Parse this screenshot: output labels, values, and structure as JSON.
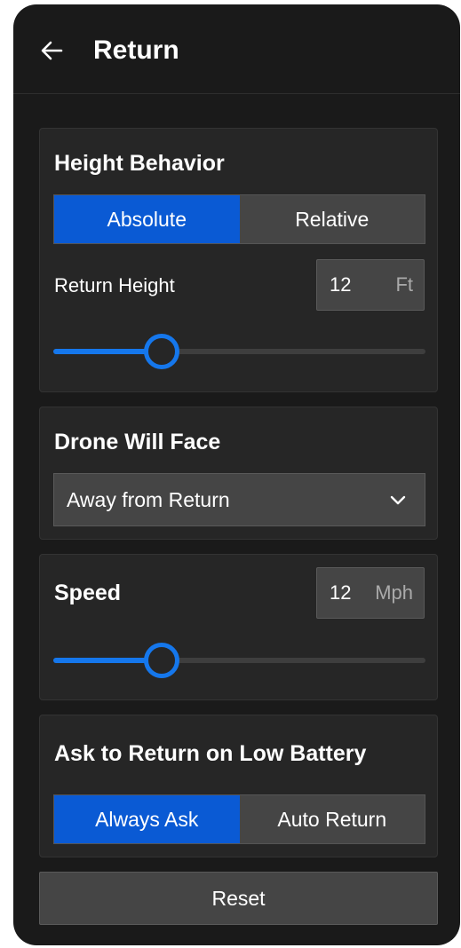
{
  "header": {
    "title": "Return",
    "back_icon": "arrow-left-icon"
  },
  "height_behavior": {
    "title": "Height Behavior",
    "options": [
      "Absolute",
      "Relative"
    ],
    "selected": "Absolute",
    "return_height": {
      "label": "Return Height",
      "value": "12",
      "unit": "Ft",
      "slider_fraction": 0.29
    }
  },
  "drone_face": {
    "title": "Drone Will Face",
    "selected": "Away from Return",
    "chevron_icon": "chevron-down-icon"
  },
  "speed": {
    "title": "Speed",
    "value": "12",
    "unit": "Mph",
    "slider_fraction": 0.29
  },
  "low_battery": {
    "title": "Ask to Return on Low Battery",
    "options": [
      "Always Ask",
      "Auto Return"
    ],
    "selected": "Always Ask"
  },
  "reset_label": "Reset",
  "colors": {
    "accent": "#1577ec",
    "selected_segment": "#0a5ad4",
    "panel_background": "#1a1a1a",
    "card_background": "#262626",
    "control_background": "#454545"
  }
}
